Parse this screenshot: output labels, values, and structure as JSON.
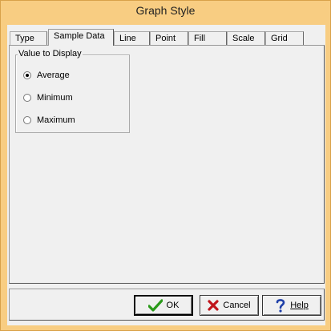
{
  "window": {
    "title": "Graph Style"
  },
  "tabs": [
    "Type",
    "Sample Data",
    "Line",
    "Point",
    "Fill",
    "Scale",
    "Grid"
  ],
  "active_tab": "Sample Data",
  "group": {
    "legend": "Value to Display",
    "options": [
      "Average",
      "Minimum",
      "Maximum"
    ],
    "selected": "Average"
  },
  "buttons": {
    "ok": "OK",
    "cancel": "Cancel",
    "help": "Help"
  },
  "colors": {
    "titlebar": "#f8cd82",
    "ok_check": "#2a9a1a",
    "cancel_x": "#c0141b",
    "help_q": "#1e3fa8"
  }
}
